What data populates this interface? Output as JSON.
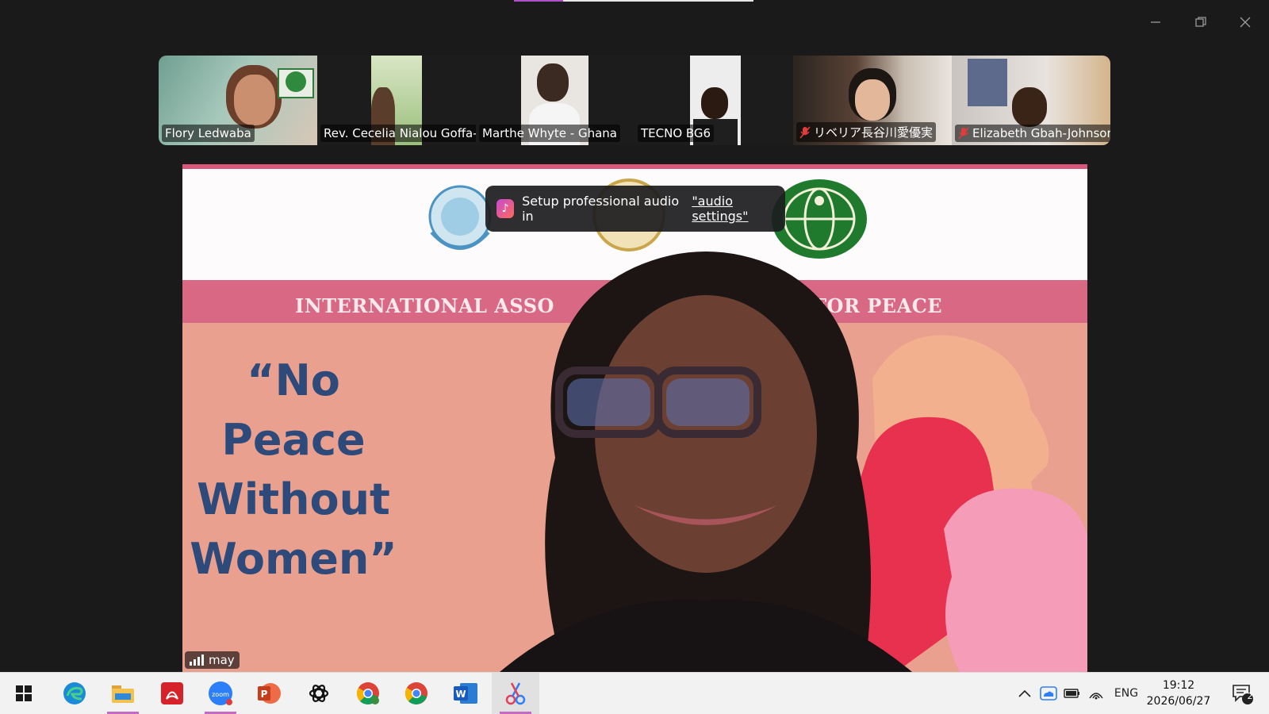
{
  "participants": [
    {
      "name": "Flory Ledwaba",
      "muted": false
    },
    {
      "name": "Rev. Cecelia Nialou Goffa-...",
      "muted": false
    },
    {
      "name": "Marthe Whyte - Ghana",
      "muted": false
    },
    {
      "name": "TECNO BG6",
      "muted": false
    },
    {
      "name": "リベリア長谷川愛優実",
      "muted": true
    },
    {
      "name": "Elizabeth Gbah-Johnson",
      "muted": true
    }
  ],
  "main_video": {
    "banner_left": "INTERNATIONAL ASSO",
    "banner_right": "FOR PEACE",
    "slogan_lines": [
      "“No",
      "Peace",
      "Without",
      "Women”"
    ],
    "self_label": "may"
  },
  "toast": {
    "text": "Setup professional audio in",
    "link": "\"audio settings\""
  },
  "taskbar": {
    "language": "ENG",
    "time": "19:12",
    "date": "2026/06/27",
    "notification_count": "2"
  },
  "colors": {
    "accent": "#c46ac0",
    "banner_pink": "#d96885",
    "slogan_blue": "#2d4a7a"
  }
}
